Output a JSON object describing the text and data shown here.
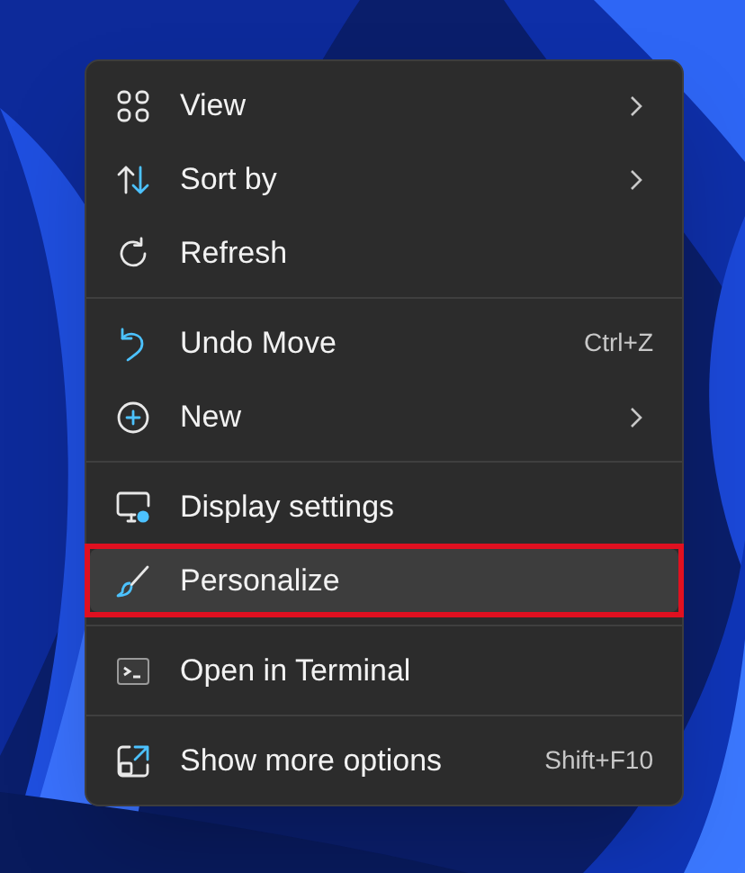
{
  "menu": {
    "groups": [
      {
        "items": [
          {
            "label": "View",
            "submenu": true,
            "selected": false,
            "outlined": false
          },
          {
            "label": "Sort by",
            "submenu": true,
            "selected": false,
            "outlined": false
          },
          {
            "label": "Refresh",
            "submenu": false,
            "selected": false,
            "outlined": false
          }
        ]
      },
      {
        "items": [
          {
            "label": "Undo Move",
            "shortcut": "Ctrl+Z",
            "submenu": false,
            "selected": false,
            "outlined": false
          },
          {
            "label": "New",
            "submenu": true,
            "selected": false,
            "outlined": false
          }
        ]
      },
      {
        "items": [
          {
            "label": "Display settings",
            "submenu": false,
            "selected": false,
            "outlined": false
          },
          {
            "label": "Personalize",
            "submenu": false,
            "selected": true,
            "outlined": true
          }
        ]
      },
      {
        "items": [
          {
            "label": "Open in Terminal",
            "submenu": false,
            "selected": false,
            "outlined": false
          }
        ]
      },
      {
        "items": [
          {
            "label": "Show more options",
            "shortcut": "Shift+F10",
            "submenu": false,
            "selected": false,
            "outlined": false
          }
        ]
      }
    ]
  }
}
